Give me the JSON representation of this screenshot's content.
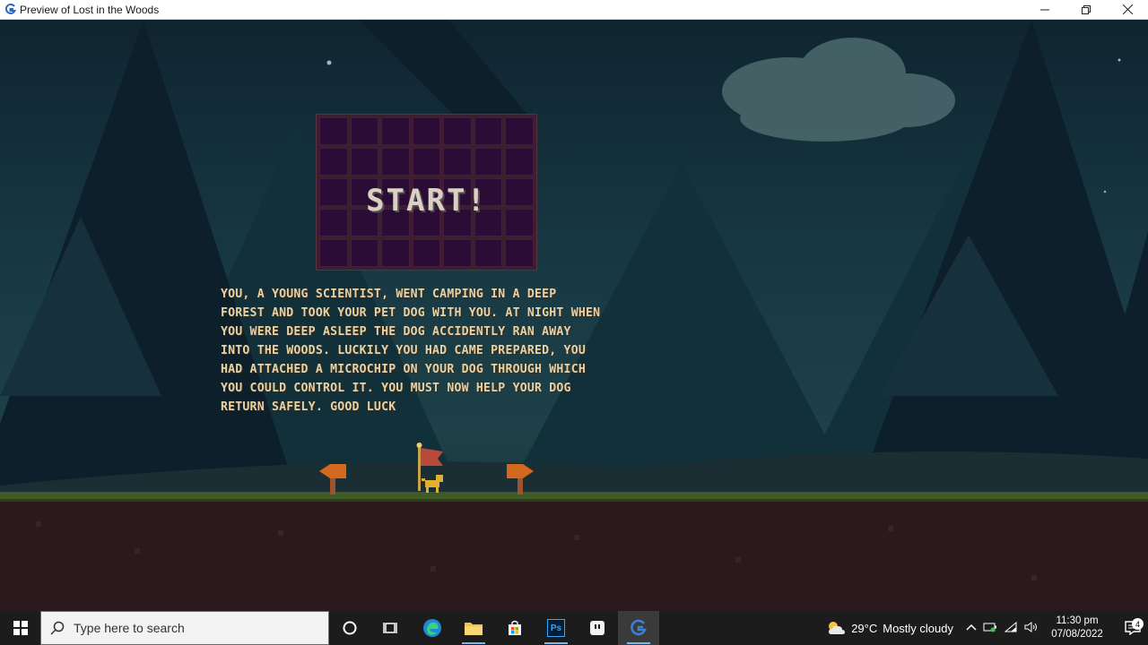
{
  "window": {
    "title": "Preview of Lost in the Woods",
    "controls": [
      "minimize-icon",
      "restore-icon",
      "close-icon"
    ]
  },
  "game": {
    "start_label": "START!",
    "story_lines": [
      "YOU, A YOUNG SCIENTIST, WENT CAMPING IN A DEEP",
      "FOREST AND TOOK YOUR PET DOG WITH YOU. AT NIGHT WHEN",
      "YOU WERE DEEP ASLEEP THE DOG ACCIDENTLY RAN AWAY",
      "INTO THE WOODS. LUCKILY YOU HAD CAME PREPARED, YOU",
      "HAD ATTACHED A MICROCHIP ON YOUR DOG THROUGH WHICH",
      "YOU COULD CONTROL IT. YOU MUST NOW HELP YOUR DOG",
      "RETURN SAFELY. GOOD LUCK"
    ],
    "sprites": [
      "signpost-left",
      "flag-with-dog",
      "signpost-right"
    ]
  },
  "taskbar": {
    "search_placeholder": "Type here to search",
    "apps": [
      "cortana-icon",
      "task-view-icon",
      "edge-icon",
      "file-explorer-icon",
      "store-icon",
      "photoshop-icon",
      "notes-app-icon",
      "gamemaker-icon"
    ],
    "photoshop_label": "Ps",
    "weather": {
      "temp": "29°C",
      "desc": "Mostly cloudy"
    },
    "clock": {
      "time": "11:30 pm",
      "date": "07/08/2022"
    },
    "notification_count": "4"
  },
  "colors": {
    "sky": "#183a45",
    "story_text": "#e6d2a4",
    "panel": "#2a0c36",
    "ground": "#2a1a1e",
    "grass": "#3f5a25"
  }
}
